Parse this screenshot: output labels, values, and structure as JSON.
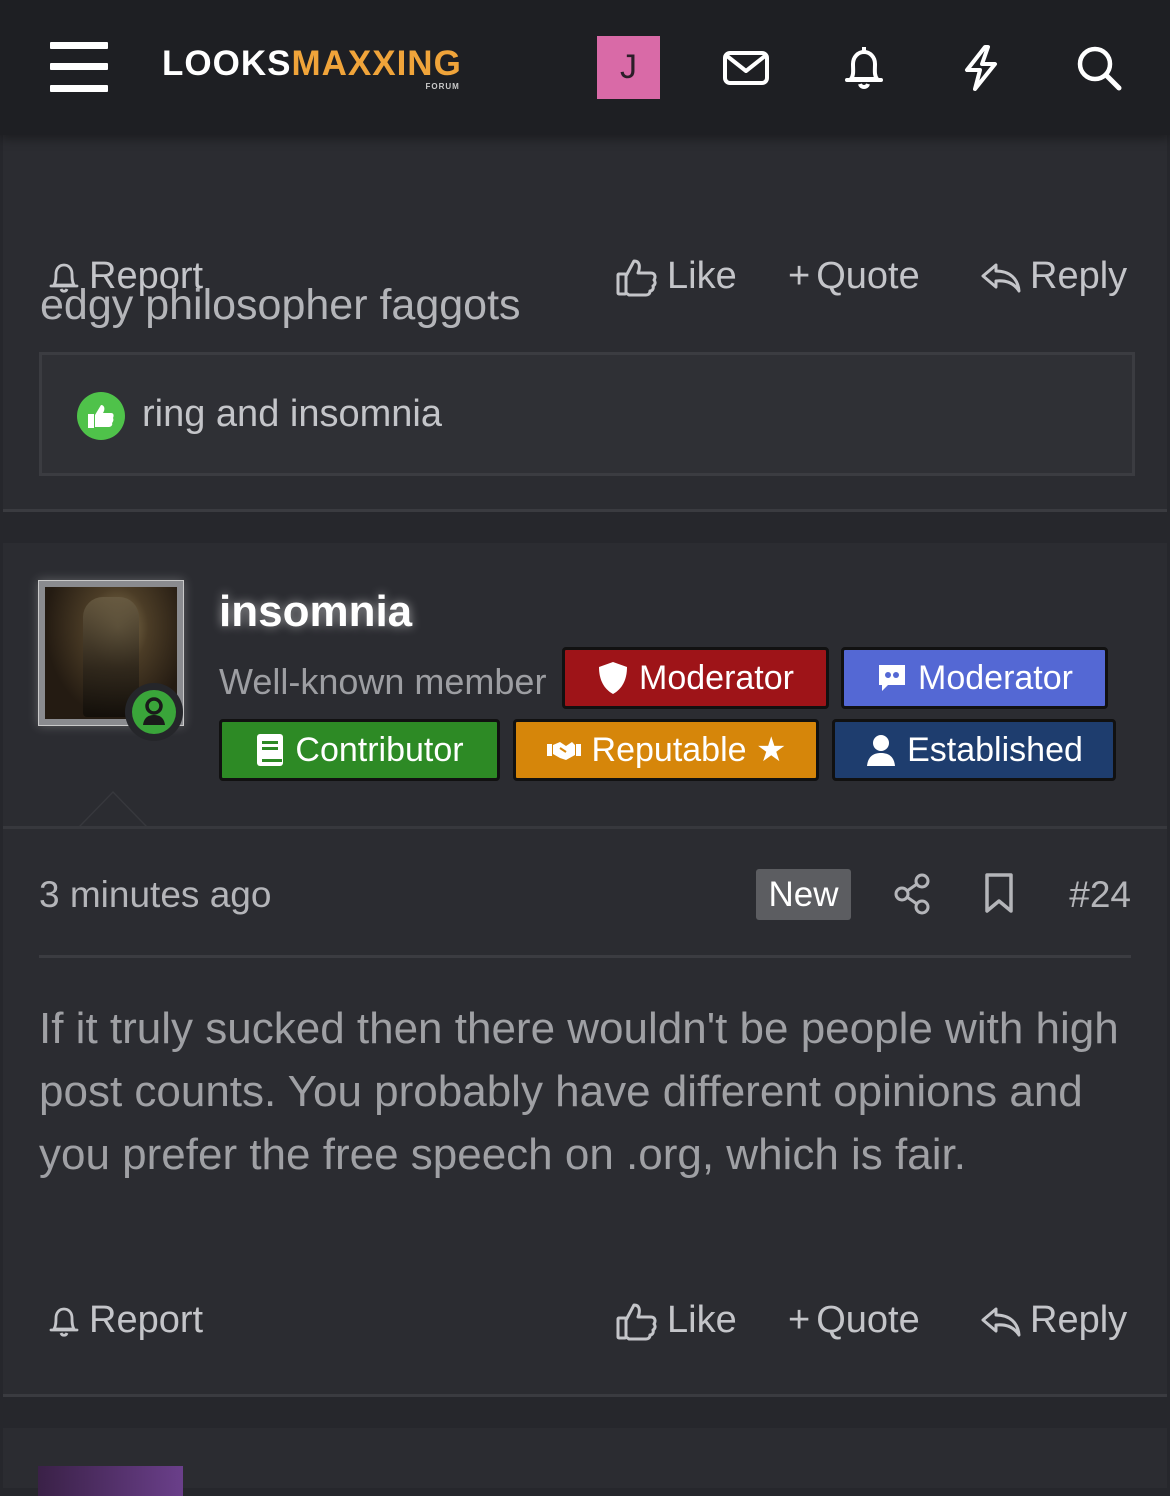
{
  "header": {
    "logo_main": "LOOKS",
    "logo_accent": "MAXXING",
    "logo_sub": "FORUM",
    "account_initial": "J",
    "icons": [
      "menu-icon",
      "mail-icon",
      "bell-icon",
      "lightning-icon",
      "search-icon"
    ]
  },
  "prev_post": {
    "text": "edgy philosopher faggots",
    "actions": {
      "report": "Report",
      "like": "Like",
      "quote": "Quote",
      "reply": "Reply"
    },
    "reactions": "ring and insomnia"
  },
  "user": {
    "name": "insomnia",
    "title": "Well-known member",
    "badges": [
      {
        "label": "Moderator",
        "color": "#9e1418",
        "icon": "shield-icon"
      },
      {
        "label": "Moderator",
        "color": "#5468d4",
        "icon": "discord-icon"
      },
      {
        "label": "Contributor",
        "color": "#2d8a25",
        "icon": "book-icon"
      },
      {
        "label": "Reputable ★",
        "color": "#d6860a",
        "icon": "handshake-icon"
      },
      {
        "label": "Established",
        "color": "#1e3d6e",
        "icon": "user-icon"
      }
    ]
  },
  "post": {
    "time": "3 minutes ago",
    "new_label": "New",
    "number": "#24",
    "body": "If it truly sucked then there wouldn't be people with high post counts. You probably have different opinions and you prefer the free speech on .org, which is fair.",
    "actions": {
      "report": "Report",
      "like": "Like",
      "quote": "Quote",
      "reply": "Reply"
    }
  }
}
